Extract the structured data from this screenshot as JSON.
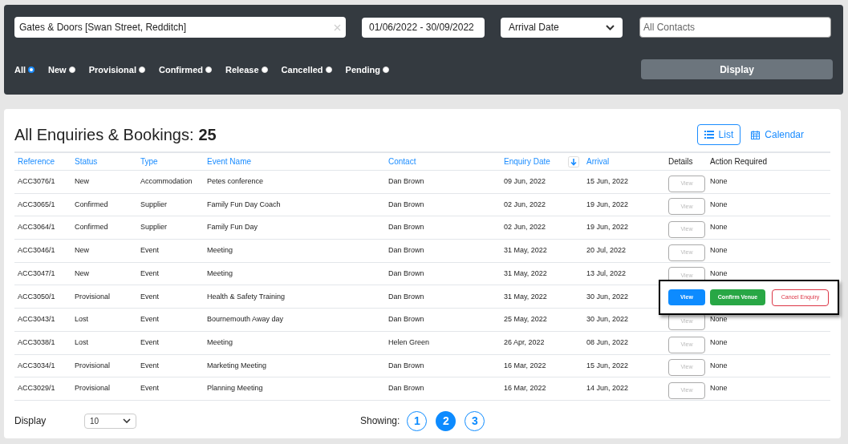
{
  "filters": {
    "venue": "Gates & Doors [Swan Street, Redditch]",
    "date_range": "01/06/2022 - 30/09/2022",
    "date_type": "Arrival Date",
    "contacts_placeholder": "All Contacts",
    "statuses": [
      {
        "label": "All",
        "selected": true
      },
      {
        "label": "New",
        "selected": false
      },
      {
        "label": "Provisional",
        "selected": false
      },
      {
        "label": "Confirmed",
        "selected": false
      },
      {
        "label": "Release",
        "selected": false
      },
      {
        "label": "Cancelled",
        "selected": false
      },
      {
        "label": "Pending",
        "selected": false
      }
    ],
    "display_button": "Display"
  },
  "heading": {
    "title": "All Enquiries & Bookings: ",
    "count": "25"
  },
  "view_toggle": [
    {
      "label": "List",
      "selected": true
    },
    {
      "label": "Calendar",
      "selected": false
    }
  ],
  "table": {
    "columns": [
      "Reference",
      "Status",
      "Type",
      "Event Name",
      "Contact",
      "Enquiry Date",
      "Arrival",
      "Details",
      "Action Required"
    ],
    "rows": [
      {
        "reference": "ACC3076/1",
        "status": "New",
        "type": "Accommodation",
        "event_name": "Petes conference",
        "contact": "Dan Brown",
        "enquiry_date": "09 Jun, 2022",
        "arrival": "15 Jun, 2022",
        "view": "View",
        "action_required": "None",
        "expanded": false
      },
      {
        "reference": "ACC3065/1",
        "status": "Confirmed",
        "type": "Supplier",
        "event_name": "Family Fun Day Coach",
        "contact": "Dan Brown",
        "enquiry_date": "02 Jun, 2022",
        "arrival": "19 Jun, 2022",
        "view": "View",
        "action_required": "None",
        "expanded": false
      },
      {
        "reference": "ACC3064/1",
        "status": "Confirmed",
        "type": "Supplier",
        "event_name": "Family Fun Day",
        "contact": "Dan Brown",
        "enquiry_date": "02 Jun, 2022",
        "arrival": "19 Jun, 2022",
        "view": "View",
        "action_required": "None",
        "expanded": false
      },
      {
        "reference": "ACC3046/1",
        "status": "New",
        "type": "Event",
        "event_name": "Meeting",
        "contact": "Dan Brown",
        "enquiry_date": "31 May, 2022",
        "arrival": "20 Jul, 2022",
        "view": "View",
        "action_required": "None",
        "expanded": false
      },
      {
        "reference": "ACC3047/1",
        "status": "New",
        "type": "Event",
        "event_name": "Meeting",
        "contact": "Dan Brown",
        "enquiry_date": "31 May, 2022",
        "arrival": "13 Jul, 2022",
        "view": "View",
        "action_required": "None",
        "expanded": false
      },
      {
        "reference": "ACC3050/1",
        "status": "Provisional",
        "type": "Event",
        "event_name": "Health & Safety Training",
        "contact": "Dan Brown",
        "enquiry_date": "31 May, 2022",
        "arrival": "30 Jun, 2022",
        "expanded": true,
        "actions": [
          {
            "kind": "view",
            "label": "View"
          },
          {
            "kind": "confirm",
            "label": "Confirm Venue"
          },
          {
            "kind": "cancel",
            "label": "Cancel Enquiry"
          }
        ]
      },
      {
        "reference": "ACC3043/1",
        "status": "Lost",
        "type": "Event",
        "event_name": "Bournemouth Away day",
        "contact": "Dan Brown",
        "enquiry_date": "25 May, 2022",
        "arrival": "30 Jun, 2022",
        "view": "View",
        "action_required": "None",
        "expanded": false
      },
      {
        "reference": "ACC3038/1",
        "status": "Lost",
        "type": "Event",
        "event_name": "Meeting",
        "contact": "Helen Green",
        "enquiry_date": "26 Apr, 2022",
        "arrival": "08 Jun, 2022",
        "view": "View",
        "action_required": "None",
        "expanded": false
      },
      {
        "reference": "ACC3034/1",
        "status": "Provisional",
        "type": "Event",
        "event_name": "Marketing Meeting",
        "contact": "Dan Brown",
        "enquiry_date": "16 Mar, 2022",
        "arrival": "15 Jun, 2022",
        "view": "View",
        "action_required": "None",
        "expanded": false
      },
      {
        "reference": "ACC3029/1",
        "status": "Provisional",
        "type": "Event",
        "event_name": "Planning Meeting",
        "contact": "Dan Brown",
        "enquiry_date": "16 Mar, 2022",
        "arrival": "14 Jun, 2022",
        "view": "View",
        "action_required": "None",
        "expanded": false
      }
    ]
  },
  "footer": {
    "display_label": "Display",
    "page_size": "10",
    "showing_label": "Showing:",
    "pages": [
      {
        "label": "1",
        "selected": false
      },
      {
        "label": "2",
        "selected": true
      },
      {
        "label": "3",
        "selected": false
      }
    ]
  }
}
